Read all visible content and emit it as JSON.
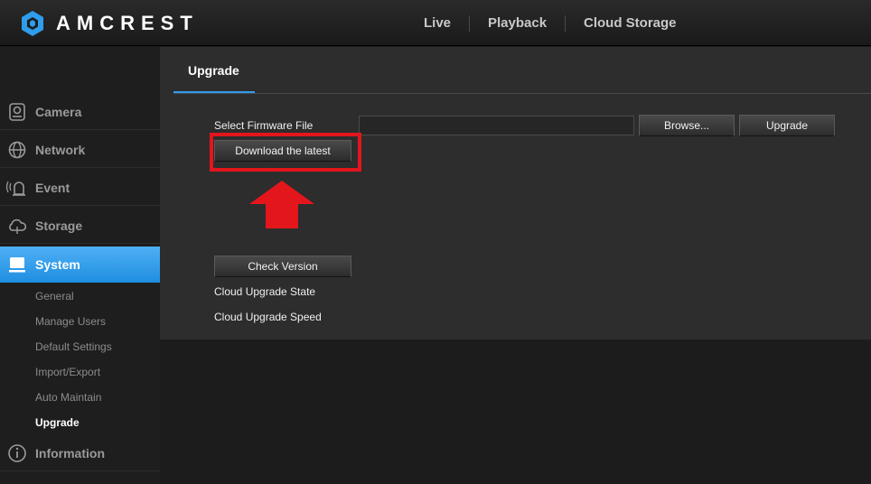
{
  "header": {
    "brand": "AMCREST",
    "nav": [
      {
        "label": "Live"
      },
      {
        "label": "Playback"
      },
      {
        "label": "Cloud Storage"
      }
    ]
  },
  "sidebar": {
    "items": [
      {
        "label": "Camera",
        "icon": "camera-icon"
      },
      {
        "label": "Network",
        "icon": "globe-icon"
      },
      {
        "label": "Event",
        "icon": "alarm-icon"
      },
      {
        "label": "Storage",
        "icon": "cloud-icon"
      },
      {
        "label": "System",
        "icon": "monitor-icon",
        "active": true
      },
      {
        "label": "Information",
        "icon": "info-icon"
      }
    ],
    "sub_items": [
      {
        "label": "General"
      },
      {
        "label": "Manage Users"
      },
      {
        "label": "Default Settings"
      },
      {
        "label": "Import/Export"
      },
      {
        "label": "Auto Maintain"
      },
      {
        "label": "Upgrade",
        "active": true
      }
    ]
  },
  "main": {
    "tab_label": "Upgrade",
    "firmware_label": "Select Firmware File",
    "firmware_value": "",
    "browse_label": "Browse...",
    "upgrade_label": "Upgrade",
    "download_label": "Download the latest",
    "check_version_label": "Check Version",
    "cloud_state_label": "Cloud Upgrade State",
    "cloud_speed_label": "Cloud Upgrade Speed"
  },
  "colors": {
    "accent": "#2f9cec",
    "annotation": "#e3161c",
    "panel": "#2d2d2d",
    "background": "#1c1c1c"
  }
}
